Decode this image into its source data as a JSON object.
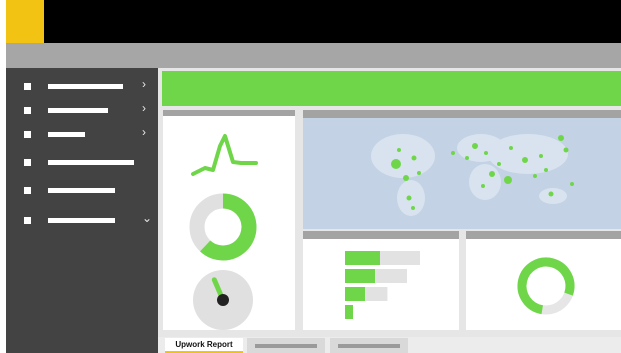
{
  "app": {
    "title_bar": {
      "logo_icon": "app-logo-icon",
      "accent": "#f2c313"
    },
    "sidebar": {
      "items": [
        {
          "icon": "square-bullet-icon",
          "has_submenu": true,
          "chevron": "›"
        },
        {
          "icon": "square-bullet-icon",
          "has_submenu": true,
          "chevron": "›"
        },
        {
          "icon": "square-bullet-icon",
          "has_submenu": true,
          "chevron": "›"
        },
        {
          "icon": "square-bullet-icon",
          "has_submenu": false,
          "chevron": ""
        },
        {
          "icon": "square-bullet-icon",
          "has_submenu": false,
          "chevron": ""
        },
        {
          "icon": "square-bullet-icon",
          "has_submenu": true,
          "chevron": "⌄"
        }
      ]
    },
    "colors": {
      "accent_green": "#6fd64a",
      "header_black": "#000000",
      "sidebar_bg": "#434343",
      "menubar_bg": "#a6a6a6",
      "map_bg": "#c3d2e4"
    },
    "widgets": {
      "line_chart": {
        "type": "sparkline-pulse"
      },
      "donut_chart": {
        "fill_fraction": 0.62
      },
      "gauge": {
        "needle_level": 0.2
      },
      "funnel_chart": {
        "bars": [
          {
            "green": 0.35,
            "grey": 0.5
          },
          {
            "green": 0.3,
            "grey": 0.4
          },
          {
            "green": 0.2,
            "grey": 0.28
          },
          {
            "green": 0.08,
            "grey": 0.0
          }
        ]
      },
      "ring_chart": {
        "fill_fraction": 0.78
      },
      "world_map": {
        "marker_color": "#6fd64a"
      }
    },
    "tabs": [
      {
        "label": "Upwork Report",
        "active": true
      },
      {
        "label": "",
        "active": false
      },
      {
        "label": "",
        "active": false
      }
    ]
  }
}
